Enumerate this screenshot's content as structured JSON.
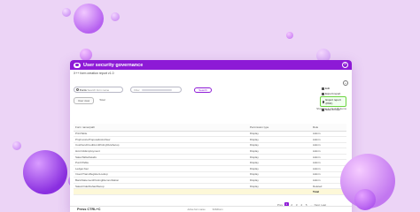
{
  "app": {
    "title": "User security governance",
    "subtitle": "X++ form creation report v1.0",
    "close_icon": "close-icon",
    "collapse_icon": "chevron-up-icon"
  },
  "toolbar": {
    "search_scope": "Form",
    "search_placeholder": "Search form name",
    "filter_placeholder": "Filter",
    "search_button": "Search"
  },
  "tabs": [
    "User view",
    "Total"
  ],
  "menu": {
    "items": [
      {
        "label": "Edit",
        "icon": "edit-icon"
      },
      {
        "label": "Export report",
        "icon": "export-icon"
      },
      {
        "label": "Export report (PDF)",
        "icon": "pdf-icon",
        "selected": true
      },
      {
        "label": "Save & Filter",
        "icon": "save-icon"
      }
    ]
  },
  "showing_text": "Showing 1-10 of 75 items",
  "table": {
    "headers": [
      "Form name/path",
      "Permission type",
      "Role"
    ],
    "rows": [
      [
        "PrintTable",
        "Display",
        "Admin"
      ],
      [
        "ProjInvoiceProposalListsView",
        "Display",
        "Admin"
      ],
      [
        "CustVendCreditLimitPolicyRuleSetup",
        "Display",
        "Admin"
      ],
      [
        "HcmInfoEmployment",
        "Display",
        "Admin"
      ],
      [
        "SalesTableDetails",
        "Display",
        "Admin"
      ],
      [
        "PurchTable",
        "Display",
        "Admin"
      ],
      [
        "LedgerJour",
        "Display",
        "Admin"
      ],
      [
        "InventTransRegisterLookup",
        "Display",
        "Admin"
      ],
      [
        "BankStatementPostingReconciliation",
        "Display",
        "Admin"
      ],
      [
        "SalesOrderDefaultSetup",
        "Display",
        "Deleted"
      ]
    ],
    "highlight_row": [
      "",
      "",
      "Total"
    ]
  },
  "pagination": {
    "prev": "Prev",
    "pages": [
      "1",
      "2",
      "3",
      "4",
      "5",
      "..."
    ],
    "active": "1",
    "next": "Next",
    "last": "Last"
  },
  "footer": {
    "left": "Press CTRL+C",
    "mid": "Active form name",
    "mid2": "SOMForm"
  }
}
